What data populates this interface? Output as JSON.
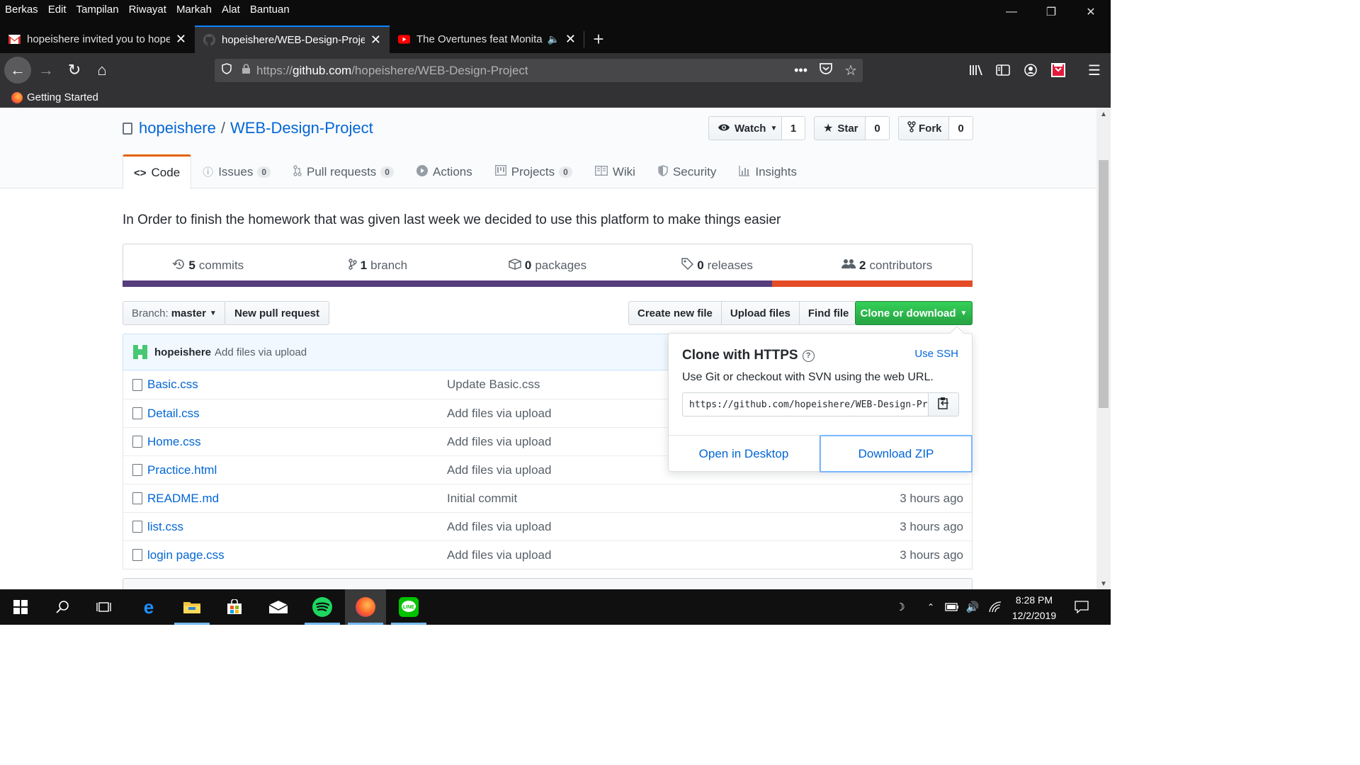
{
  "menubar": [
    "Berkas",
    "Edit",
    "Tampilan",
    "Riwayat",
    "Markah",
    "Alat",
    "Bantuan"
  ],
  "tabs": [
    {
      "title": "hopeishere invited you to hope",
      "icon": "gmail-icon"
    },
    {
      "title": "hopeishere/WEB-Design-Projec",
      "icon": "github-icon"
    },
    {
      "title": "The Overtunes feat Monita",
      "icon": "youtube-icon"
    }
  ],
  "url": {
    "prefix": "https://",
    "domain": "github.com",
    "path": "/hopeishere/WEB-Design-Project"
  },
  "bookmark": "Getting Started",
  "repo": {
    "owner": "hopeishere",
    "separator": "/",
    "name": "WEB-Design-Project",
    "watch_label": "Watch",
    "watch_count": "1",
    "star_label": "Star",
    "star_count": "0",
    "fork_label": "Fork",
    "fork_count": "0"
  },
  "nav": {
    "code": "Code",
    "issues": "Issues",
    "issues_count": "0",
    "pulls": "Pull requests",
    "pulls_count": "0",
    "actions": "Actions",
    "projects": "Projects",
    "projects_count": "0",
    "wiki": "Wiki",
    "security": "Security",
    "insights": "Insights"
  },
  "description": "In Order to finish the homework that was given last week we decided to use this platform to make things easier",
  "numbers": {
    "commits_n": "5",
    "commits": "commits",
    "branch_n": "1",
    "branch": "branch",
    "packages_n": "0",
    "packages": "packages",
    "releases_n": "0",
    "releases": "releases",
    "contributors_n": "2",
    "contributors": "contributors"
  },
  "language_colors": {
    "css": "#563d7c",
    "html": "#e34c26"
  },
  "language_share": {
    "css": 0.764,
    "html": 0.236
  },
  "toolbar": {
    "branch_prefix": "Branch:",
    "branch": "master",
    "new_pr": "New pull request",
    "create_file": "Create new file",
    "upload": "Upload files",
    "find": "Find file",
    "clone": "Clone or download"
  },
  "commit": {
    "author": "hopeishere",
    "message": "Add files via upload"
  },
  "files": [
    {
      "name": "Basic.css",
      "message": "Update Basic.css",
      "age": ""
    },
    {
      "name": "Detail.css",
      "message": "Add files via upload",
      "age": ""
    },
    {
      "name": "Home.css",
      "message": "Add files via upload",
      "age": ""
    },
    {
      "name": "Practice.html",
      "message": "Add files via upload",
      "age": ""
    },
    {
      "name": "README.md",
      "message": "Initial commit",
      "age": "3 hours ago"
    },
    {
      "name": "list.css",
      "message": "Add files via upload",
      "age": "3 hours ago"
    },
    {
      "name": "login page.css",
      "message": "Add files via upload",
      "age": "3 hours ago"
    }
  ],
  "clone": {
    "title": "Clone with HTTPS",
    "use_ssh": "Use SSH",
    "hint": "Use Git or checkout with SVN using the web URL.",
    "url": "https://github.com/hopeishere/WEB-Design-Project.git",
    "open_desktop": "Open in Desktop",
    "download_zip": "Download ZIP"
  },
  "taskbar": {
    "time": "8:28 PM",
    "date": "12/2/2019"
  }
}
